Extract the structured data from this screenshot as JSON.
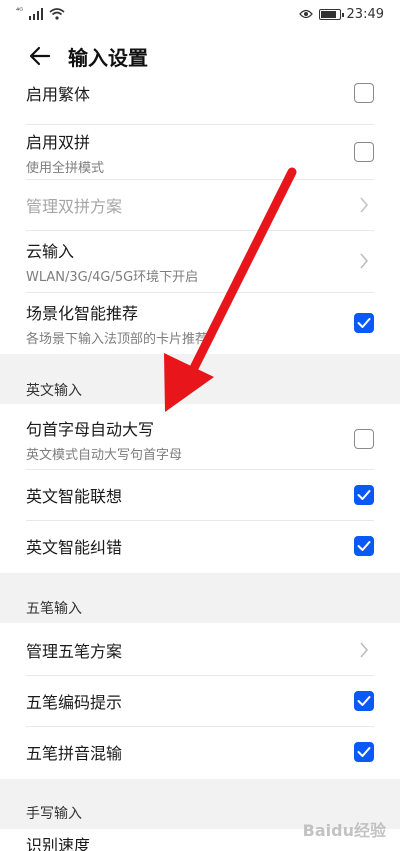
{
  "status": {
    "signal": "⁴ᴳ",
    "time": "23:49"
  },
  "header": {
    "title": "输入设置"
  },
  "rows_top": [
    {
      "label": "启用繁体",
      "control": "checkbox",
      "checked": false
    },
    {
      "label": "启用双拼",
      "sub": "使用全拼模式",
      "control": "checkbox",
      "checked": false
    },
    {
      "label": "管理双拼方案",
      "control": "chevron",
      "disabled": true
    },
    {
      "label": "云输入",
      "sub": "WLAN/3G/4G/5G环境下开启",
      "control": "chevron"
    },
    {
      "label": "场景化智能推荐",
      "sub": "各场景下输入法顶部的卡片推荐",
      "control": "checkbox",
      "checked": true
    }
  ],
  "section_english": {
    "title": "英文输入"
  },
  "rows_english": [
    {
      "label": "句首字母自动大写",
      "sub": "英文模式自动大写句首字母",
      "control": "checkbox",
      "checked": false
    },
    {
      "label": "英文智能联想",
      "control": "checkbox",
      "checked": true
    },
    {
      "label": "英文智能纠错",
      "control": "checkbox",
      "checked": true
    }
  ],
  "section_wubi": {
    "title": "五笔输入"
  },
  "rows_wubi": [
    {
      "label": "管理五笔方案",
      "control": "chevron"
    },
    {
      "label": "五笔编码提示",
      "control": "checkbox",
      "checked": true
    },
    {
      "label": "五笔拼音混输",
      "control": "checkbox",
      "checked": true
    }
  ],
  "section_handwriting": {
    "title": "手写输入"
  },
  "rows_handwriting": [
    {
      "label": "识别速度"
    }
  ],
  "watermark": "Baidu经验",
  "colors": {
    "accent": "#0a59f7",
    "arrow": "#e8161b"
  }
}
